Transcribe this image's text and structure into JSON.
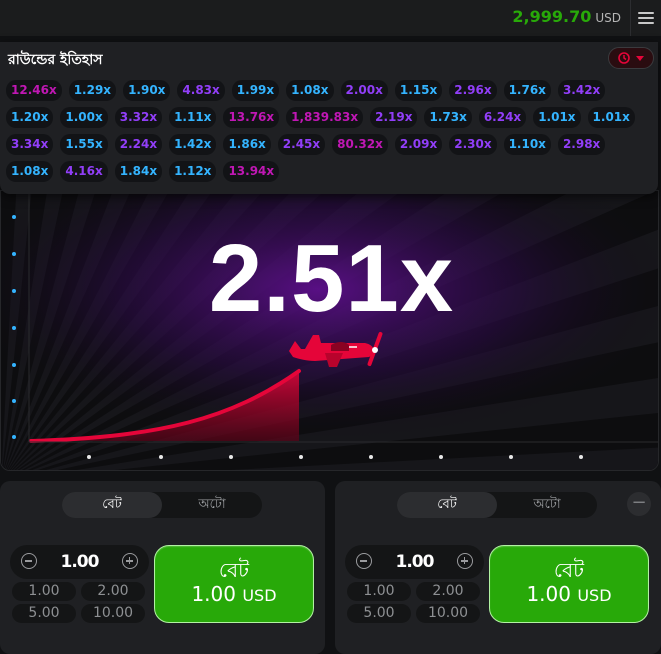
{
  "header": {
    "balance": "2,999.70",
    "currency": "USD",
    "menu_icon": "hamburger-icon"
  },
  "history": {
    "title": "রাউন্ডের ইতিহাস",
    "toggle_icons": [
      "history-icon",
      "chevron-down-icon"
    ],
    "colors": {
      "blue": "#34b4ff",
      "purple": "#913ef8",
      "pink": "#c017b4"
    },
    "items": [
      {
        "value": "12.46x",
        "color": "pink"
      },
      {
        "value": "1.29x",
        "color": "blue"
      },
      {
        "value": "1.90x",
        "color": "blue"
      },
      {
        "value": "4.83x",
        "color": "purple"
      },
      {
        "value": "1.99x",
        "color": "blue"
      },
      {
        "value": "1.08x",
        "color": "blue"
      },
      {
        "value": "2.00x",
        "color": "purple"
      },
      {
        "value": "1.15x",
        "color": "blue"
      },
      {
        "value": "2.96x",
        "color": "purple"
      },
      {
        "value": "1.76x",
        "color": "blue"
      },
      {
        "value": "3.42x",
        "color": "purple"
      },
      {
        "value": "1.20x",
        "color": "blue"
      },
      {
        "value": "1.00x",
        "color": "blue"
      },
      {
        "value": "3.32x",
        "color": "purple"
      },
      {
        "value": "1.11x",
        "color": "blue"
      },
      {
        "value": "13.76x",
        "color": "pink"
      },
      {
        "value": "1,839.83x",
        "color": "pink"
      },
      {
        "value": "2.19x",
        "color": "purple"
      },
      {
        "value": "1.73x",
        "color": "blue"
      },
      {
        "value": "6.24x",
        "color": "purple"
      },
      {
        "value": "1.01x",
        "color": "blue"
      },
      {
        "value": "1.01x",
        "color": "blue"
      },
      {
        "value": "3.34x",
        "color": "purple"
      },
      {
        "value": "1.55x",
        "color": "blue"
      },
      {
        "value": "2.24x",
        "color": "purple"
      },
      {
        "value": "1.42x",
        "color": "blue"
      },
      {
        "value": "1.86x",
        "color": "blue"
      },
      {
        "value": "2.45x",
        "color": "purple"
      },
      {
        "value": "80.32x",
        "color": "pink"
      },
      {
        "value": "2.09x",
        "color": "purple"
      },
      {
        "value": "2.30x",
        "color": "purple"
      },
      {
        "value": "1.10x",
        "color": "blue"
      },
      {
        "value": "2.98x",
        "color": "purple"
      },
      {
        "value": "1.08x",
        "color": "blue"
      },
      {
        "value": "4.16x",
        "color": "purple"
      },
      {
        "value": "1.84x",
        "color": "blue"
      },
      {
        "value": "1.12x",
        "color": "blue"
      },
      {
        "value": "13.94x",
        "color": "pink"
      }
    ]
  },
  "game": {
    "multiplier": "2.51x",
    "plane_color": "#e50539",
    "accent": "#5c0f8a"
  },
  "bet_panels": [
    {
      "tabs": [
        "বেট",
        "অটো"
      ],
      "active_tab": "বেট",
      "amount": "1.00",
      "quick_amounts": [
        "1.00",
        "2.00",
        "5.00",
        "10.00"
      ],
      "bet_label": "বেট",
      "bet_amount": "1.00",
      "bet_currency": "USD"
    },
    {
      "tabs": [
        "বেট",
        "অটো"
      ],
      "active_tab": "বেট",
      "amount": "1.00",
      "quick_amounts": [
        "1.00",
        "2.00",
        "5.00",
        "10.00"
      ],
      "bet_label": "বেট",
      "bet_amount": "1.00",
      "bet_currency": "USD",
      "remove_label": "−"
    }
  ]
}
